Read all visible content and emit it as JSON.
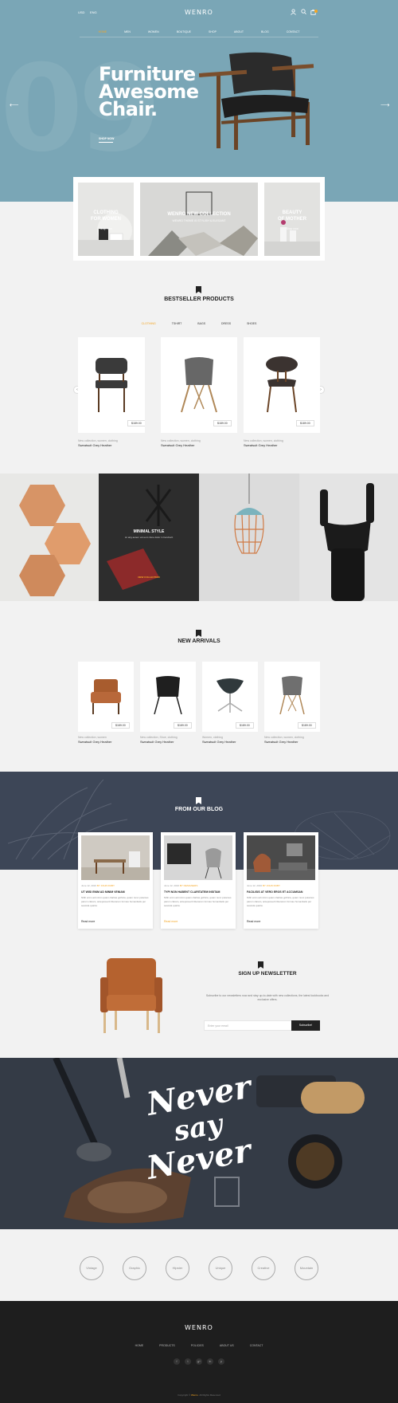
{
  "header": {
    "currency": "USD",
    "language": "ENG",
    "logo": "WENRO",
    "nav": [
      "HOME",
      "MEN",
      "WOMEN",
      "BOUTIQUE",
      "SHOP",
      "ABOUT",
      "BLOG",
      "CONTACT"
    ],
    "active_nav": "HOME"
  },
  "hero": {
    "title_line1": "Furniture",
    "title_line2": "Awesome",
    "title_line3": "Chair.",
    "bg_number": "09",
    "cta": "SHOP NOW"
  },
  "collections": [
    {
      "title_line1": "CLOTHING",
      "title_line2": "FOR WOMEN",
      "sub": "Shop now"
    },
    {
      "title_line1": "WENRO NEW COLLECTION",
      "title_line2": "",
      "sub": "WENRO THEME IS STYLISH & ELEGANT"
    },
    {
      "title_line1": "BEAUTY",
      "title_line2": "OF MOTHER",
      "sub": "Shop now"
    }
  ],
  "bestseller": {
    "title": "BESTSELLER PRODUCTS",
    "tabs": [
      "CLOTHING",
      "TSHIRT",
      "BAGS",
      "DRESS",
      "SHOES"
    ],
    "active_tab": "CLOTHING",
    "products": [
      {
        "price": "$189.00",
        "category": "New collection, women, clothing",
        "name": "Sweatsuit Grey Heather"
      },
      {
        "price": "$189.00",
        "category": "New collection, women, clothing",
        "name": "Sweatsuit Grey Heather"
      },
      {
        "price": "$189.00",
        "category": "New collection, women, clothing",
        "name": "Sweatsuit Grey Heather"
      }
    ]
  },
  "banner": {
    "title": "MINIMAL STYLE",
    "sub": "Lit arig autem vel eum iriure dolor in hendrerit",
    "cta": "NEW COLLECTION"
  },
  "new_arrivals": {
    "title": "NEW ARRIVALS",
    "products": [
      {
        "price": "$189.00",
        "category": "New collection, women",
        "name": "Sweatsuit Grey Heather"
      },
      {
        "price": "$189.00",
        "category": "New collection, Shoe, clothing",
        "name": "Sweatsuit Grey Heather"
      },
      {
        "price": "$189.00",
        "category": "Women, clothing",
        "name": "Sweatsuit Grey Heather"
      },
      {
        "price": "$189.00",
        "category": "New collection, women, clothing",
        "name": "Sweatsuit Grey Heather"
      }
    ]
  },
  "blog": {
    "title": "FROM OUR BLOG",
    "posts": [
      {
        "date": "June 12, 2016",
        "tag": "BY JOHN RUBY",
        "title": "UT WISI ENIM AD MINIM VENIAM",
        "excerpt": "Nibh enim ad minim quam claritas gothica, quam nunc putamus parum claram, anteposuerit litterarum formas humanitatis per seacula quarta.",
        "more": "Read more"
      },
      {
        "date": "June 12, 2016",
        "tag": "BY DESIGNERS",
        "title": "TYPI NON HABENT CLARITATEM INSITAM",
        "excerpt": "Nibh enim ad minim quam claritas gothica, quam nunc putamus parum claram, anteposuerit litterarum formas humanitatis per seacula quarta.",
        "more": "Read more"
      },
      {
        "date": "June 12, 2016",
        "tag": "BY JOHN RUBY",
        "title": "FACILISIS AT VERO EROS ET ACCUMSAN",
        "excerpt": "Nibh enim ad minim quam claritas gothica, quam nunc putamus parum claram, anteposuerit litterarum formas humanitatis per seacula quarta.",
        "more": "Read more"
      }
    ]
  },
  "newsletter": {
    "title": "SIGN UP NEWSLETTER",
    "text": "Subscribe to our newsletters now and stay up-to-date with new collections, the latest lookbooks and exclusive offers.",
    "placeholder": "Enter your email",
    "button": "Subscribe!"
  },
  "quote": {
    "line1": "Never",
    "line2": "say",
    "line3": "Never"
  },
  "brands": [
    "Vintage",
    "Graphic",
    "Hipster",
    "Unique",
    "Creative",
    "Mountain"
  ],
  "footer": {
    "logo": "WENRO",
    "nav": [
      "HOME",
      "PRODUCTS",
      "POLICIES",
      "ABOUT US",
      "CONTACT"
    ],
    "social": [
      "f",
      "t",
      "g+",
      "in",
      "p"
    ],
    "copyright_prefix": "Copyright ©",
    "copyright_brand": "Wenro",
    "copyright_suffix": ". All Rights Reserved"
  },
  "colors": {
    "accent": "#f5a623",
    "hero_bg": "#7aa6b6",
    "dark": "#222222"
  }
}
